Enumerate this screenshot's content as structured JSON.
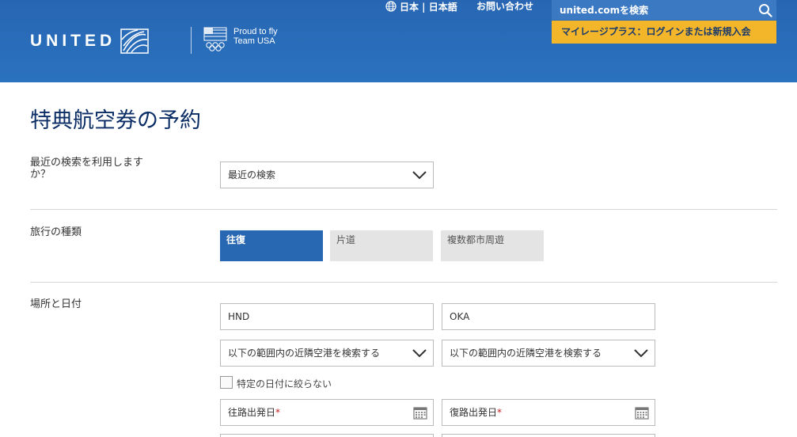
{
  "header": {
    "brand": "UNITED",
    "teamusa_line1": "Proud to fly",
    "teamusa_line2": "Team USA",
    "language": "日本 | 日本語",
    "contact": "お問い合わせ",
    "search_placeholder": "united.comを検索",
    "mileageplus": "マイレージプラス：ログインまたは新規入会",
    "colors": {
      "header_blue": "#2866b3",
      "mileageplus_gold": "#f3b52a"
    }
  },
  "page": {
    "title": "特典航空券の予約"
  },
  "recent": {
    "label": "最近の検索を利用しますか？",
    "select_value": "最近の検索"
  },
  "trip_type": {
    "label": "旅行の種類",
    "options": [
      "往復",
      "片道",
      "複数都市周遊"
    ],
    "selected": "往復"
  },
  "location": {
    "label": "場所と日付",
    "origin": "HND",
    "destination": "OKA",
    "origin_nearby": "以下の範囲内の近隣空港を検索する",
    "destination_nearby": "以下の範囲内の近隣空港を検索する",
    "flexible_dates": "特定の日付に絞らない",
    "depart_label": "往路出発日",
    "return_label": "復路出発日",
    "required_mark": "*"
  }
}
